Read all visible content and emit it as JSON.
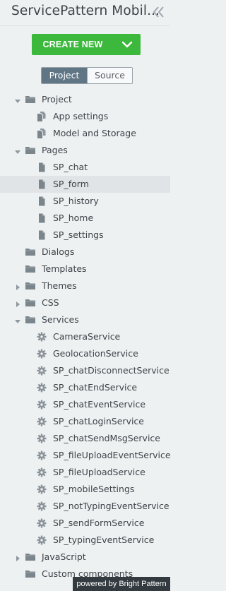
{
  "header": {
    "title": "ServicePattern Mobil...",
    "collapse_icon": "double-chevron-left-icon"
  },
  "create_button": {
    "label": "CREATE NEW",
    "caret_icon": "chevron-down-icon",
    "color": "#3cb83c"
  },
  "tabs": {
    "active": "Project",
    "inactive": "Source"
  },
  "tree": [
    {
      "label": "Project",
      "depth": 0,
      "kind": "folder",
      "toggle": "open"
    },
    {
      "label": "App settings",
      "depth": 1,
      "kind": "doc-stack"
    },
    {
      "label": "Model and Storage",
      "depth": 1,
      "kind": "doc-stack"
    },
    {
      "label": "Pages",
      "depth": 0,
      "kind": "folder",
      "toggle": "open"
    },
    {
      "label": "SP_chat",
      "depth": 1,
      "kind": "doc"
    },
    {
      "label": "SP_form",
      "depth": 1,
      "kind": "doc",
      "selected": true
    },
    {
      "label": "SP_history",
      "depth": 1,
      "kind": "doc"
    },
    {
      "label": "SP_home",
      "depth": 1,
      "kind": "doc"
    },
    {
      "label": "SP_settings",
      "depth": 1,
      "kind": "doc"
    },
    {
      "label": "Dialogs",
      "depth": 0,
      "kind": "folder",
      "toggle": "none"
    },
    {
      "label": "Templates",
      "depth": 0,
      "kind": "folder",
      "toggle": "none"
    },
    {
      "label": "Themes",
      "depth": 0,
      "kind": "folder",
      "toggle": "closed"
    },
    {
      "label": "CSS",
      "depth": 0,
      "kind": "folder",
      "toggle": "closed"
    },
    {
      "label": "Services",
      "depth": 0,
      "kind": "folder",
      "toggle": "open"
    },
    {
      "label": "CameraService",
      "depth": 1,
      "kind": "gear"
    },
    {
      "label": "GeolocationService",
      "depth": 1,
      "kind": "gear"
    },
    {
      "label": "SP_chatDisconnectService",
      "depth": 1,
      "kind": "gear"
    },
    {
      "label": "SP_chatEndService",
      "depth": 1,
      "kind": "gear"
    },
    {
      "label": "SP_chatEventService",
      "depth": 1,
      "kind": "gear"
    },
    {
      "label": "SP_chatLoginService",
      "depth": 1,
      "kind": "gear"
    },
    {
      "label": "SP_chatSendMsgService",
      "depth": 1,
      "kind": "gear"
    },
    {
      "label": "SP_fileUploadEventService",
      "depth": 1,
      "kind": "gear"
    },
    {
      "label": "SP_fileUploadService",
      "depth": 1,
      "kind": "gear"
    },
    {
      "label": "SP_mobileSettings",
      "depth": 1,
      "kind": "gear"
    },
    {
      "label": "SP_notTypingEventService",
      "depth": 1,
      "kind": "gear"
    },
    {
      "label": "SP_sendFormService",
      "depth": 1,
      "kind": "gear"
    },
    {
      "label": "SP_typingEventService",
      "depth": 1,
      "kind": "gear"
    },
    {
      "label": "JavaScript",
      "depth": 0,
      "kind": "folder",
      "toggle": "closed"
    },
    {
      "label": "Custom components",
      "depth": 0,
      "kind": "folder",
      "toggle": "none"
    }
  ],
  "footer_badge": "powered by Bright Pattern"
}
